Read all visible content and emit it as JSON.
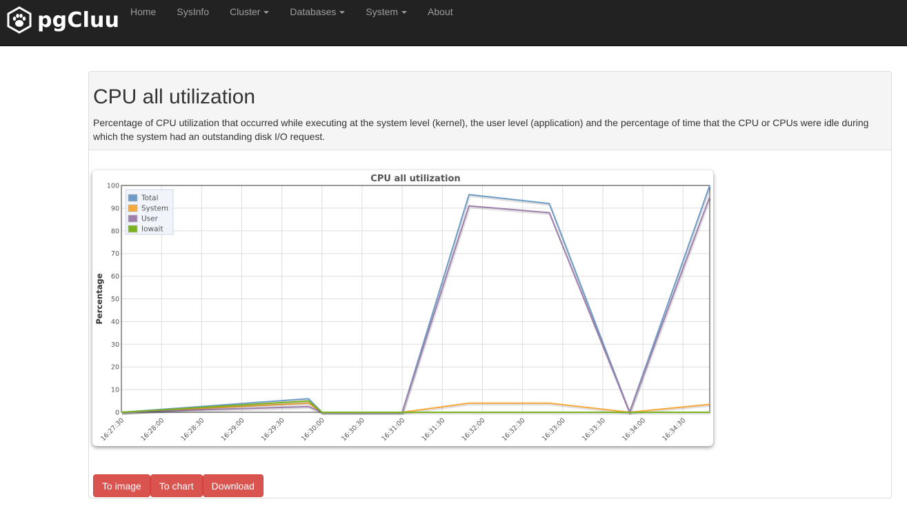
{
  "navbar": {
    "brand": "pgCluu",
    "items": [
      {
        "label": "Home",
        "dropdown": false
      },
      {
        "label": "SysInfo",
        "dropdown": false
      },
      {
        "label": "Cluster",
        "dropdown": true
      },
      {
        "label": "Databases",
        "dropdown": true
      },
      {
        "label": "System",
        "dropdown": true
      },
      {
        "label": "About",
        "dropdown": false
      }
    ]
  },
  "panel": {
    "title": "CPU all utilization",
    "description": "Percentage of CPU utilization that occurred while executing at the system level (kernel), the user level (application) and the percentage of time that the CPU or CPUs were idle during which the system had an outstanding disk I/O request."
  },
  "buttons": {
    "to_image": "To image",
    "to_chart": "To chart",
    "download": "Download"
  },
  "colors": {
    "navbar_bg": "#222222",
    "button_danger": "#d9534f",
    "series_total": "#6e9cc6",
    "series_system": "#f6a83b",
    "series_user": "#9f7fae",
    "series_iowait": "#79b21b"
  },
  "chart_data": {
    "type": "line",
    "title": "CPU all utilization",
    "xlabel": "",
    "ylabel": "Percentage",
    "ylim": [
      0,
      100
    ],
    "yticks": [
      0,
      10,
      20,
      30,
      40,
      50,
      60,
      70,
      80,
      90,
      100
    ],
    "xlim": [
      "16:27:30",
      "16:34:50"
    ],
    "xticks": [
      "16:27:30",
      "16:28:00",
      "16:28:30",
      "16:29:00",
      "16:29:30",
      "16:30:00",
      "16:30:30",
      "16:31:00",
      "16:31:30",
      "16:32:00",
      "16:32:30",
      "16:33:00",
      "16:33:30",
      "16:34:00",
      "16:34:30"
    ],
    "grid": true,
    "legend_position": "top-left",
    "series": [
      {
        "name": "Total",
        "color": "#6e9cc6",
        "points": [
          [
            "16:27:30",
            0
          ],
          [
            "16:29:50",
            6
          ],
          [
            "16:30:00",
            0
          ],
          [
            "16:31:00",
            0
          ],
          [
            "16:31:50",
            96
          ],
          [
            "16:32:50",
            92
          ],
          [
            "16:33:50",
            0
          ],
          [
            "16:34:50",
            100
          ]
        ]
      },
      {
        "name": "System",
        "color": "#f6a83b",
        "points": [
          [
            "16:27:30",
            0
          ],
          [
            "16:29:50",
            4
          ],
          [
            "16:30:00",
            0
          ],
          [
            "16:31:00",
            0
          ],
          [
            "16:31:50",
            4
          ],
          [
            "16:32:50",
            4
          ],
          [
            "16:33:50",
            0
          ],
          [
            "16:34:50",
            3.5
          ]
        ]
      },
      {
        "name": "User",
        "color": "#9f7fae",
        "points": [
          [
            "16:27:30",
            0
          ],
          [
            "16:29:50",
            2.5
          ],
          [
            "16:30:00",
            0
          ],
          [
            "16:31:00",
            0
          ],
          [
            "16:31:50",
            91
          ],
          [
            "16:32:50",
            88
          ],
          [
            "16:33:50",
            0
          ],
          [
            "16:34:50",
            95
          ]
        ]
      },
      {
        "name": "Iowait",
        "color": "#79b21b",
        "points": [
          [
            "16:27:30",
            0
          ],
          [
            "16:29:50",
            5
          ],
          [
            "16:30:00",
            0
          ],
          [
            "16:31:00",
            0
          ],
          [
            "16:31:50",
            0
          ],
          [
            "16:32:50",
            0
          ],
          [
            "16:33:50",
            0
          ],
          [
            "16:34:50",
            0
          ]
        ]
      }
    ]
  }
}
